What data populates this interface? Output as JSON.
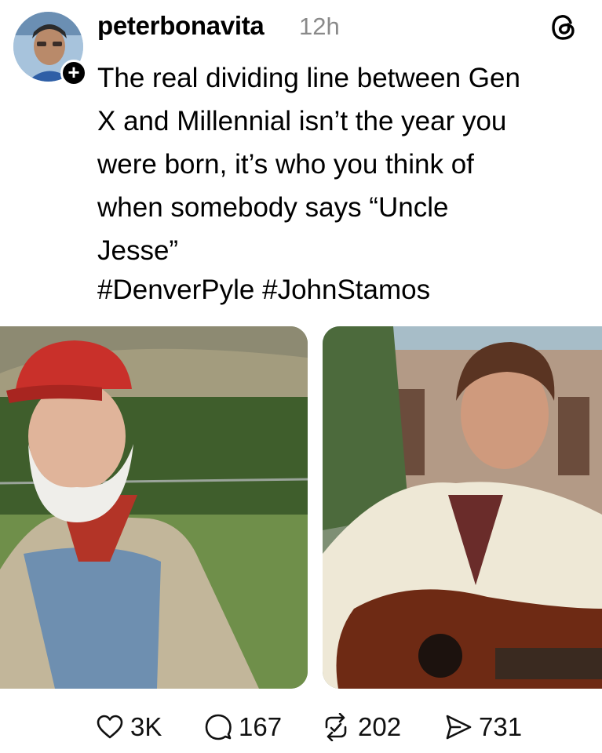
{
  "post": {
    "username": "peterbonavita",
    "timestamp": "12h",
    "text": "The real dividing line between Gen\nX and Millennial isn’t the year you\nwere born, it’s who you think of\nwhen somebody says “Uncle\nJesse”",
    "hashtags": "#DenverPyle #JohnStamos"
  },
  "actions": {
    "likes": "3K",
    "replies": "167",
    "reposts": "202",
    "shares": "731"
  },
  "icons": {
    "follow": "plus-icon",
    "brand": "threads-logo-icon",
    "like": "heart-icon",
    "reply": "comment-icon",
    "repost": "repost-icon",
    "share": "send-icon"
  }
}
